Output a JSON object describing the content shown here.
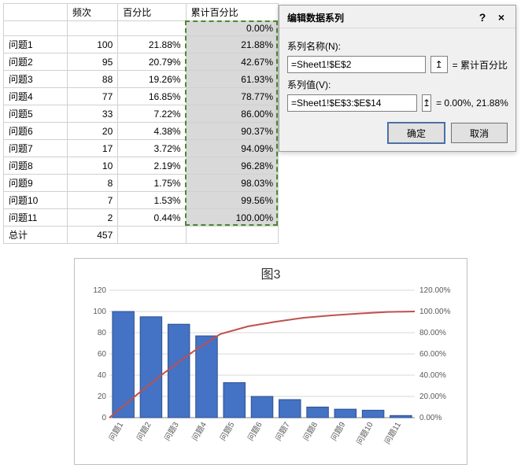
{
  "sheet": {
    "headers": {
      "row_label": "",
      "freq": "频次",
      "pct": "百分比",
      "cum": "累计百分比"
    },
    "first_cum": "0.00%",
    "rows": [
      {
        "label": "问题1",
        "freq": 100,
        "pct": "21.88%",
        "cum": "21.88%"
      },
      {
        "label": "问题2",
        "freq": 95,
        "pct": "20.79%",
        "cum": "42.67%"
      },
      {
        "label": "问题3",
        "freq": 88,
        "pct": "19.26%",
        "cum": "61.93%"
      },
      {
        "label": "问题4",
        "freq": 77,
        "pct": "16.85%",
        "cum": "78.77%"
      },
      {
        "label": "问题5",
        "freq": 33,
        "pct": "7.22%",
        "cum": "86.00%"
      },
      {
        "label": "问题6",
        "freq": 20,
        "pct": "4.38%",
        "cum": "90.37%"
      },
      {
        "label": "问题7",
        "freq": 17,
        "pct": "3.72%",
        "cum": "94.09%"
      },
      {
        "label": "问题8",
        "freq": 10,
        "pct": "2.19%",
        "cum": "96.28%"
      },
      {
        "label": "问题9",
        "freq": 8,
        "pct": "1.75%",
        "cum": "98.03%"
      },
      {
        "label": "问题10",
        "freq": 7,
        "pct": "1.53%",
        "cum": "99.56%"
      },
      {
        "label": "问题11",
        "freq": 2,
        "pct": "0.44%",
        "cum": "100.00%"
      }
    ],
    "total": {
      "label": "总计",
      "freq": 457
    }
  },
  "dialog": {
    "title": "编辑数据系列",
    "help_icon": "?",
    "close_icon": "×",
    "name_label": "系列名称(N):",
    "name_value": "=Sheet1!$E$2",
    "name_preview": "= 累计百分比",
    "values_label": "系列值(V):",
    "values_value": "=Sheet1!$E$3:$E$14",
    "values_preview": "= 0.00%, 21.88%",
    "ref_icon": "↥",
    "ok_label": "确定",
    "cancel_label": "取消"
  },
  "chart_data": {
    "type": "bar+line",
    "title": "图3",
    "categories": [
      "问题1",
      "问题2",
      "问题3",
      "问题4",
      "问题5",
      "问题6",
      "问题7",
      "问题8",
      "问题9",
      "问题10",
      "问题11"
    ],
    "series": [
      {
        "name": "频次",
        "kind": "bar",
        "axis": "left",
        "values": [
          100,
          95,
          88,
          77,
          33,
          20,
          17,
          10,
          8,
          7,
          2
        ]
      },
      {
        "name": "累计百分比",
        "kind": "line",
        "axis": "right",
        "values": [
          0.0,
          21.88,
          42.67,
          61.93,
          78.77,
          86.0,
          90.37,
          94.09,
          96.28,
          98.03,
          99.56,
          100.0
        ]
      }
    ],
    "y_left": {
      "min": 0,
      "max": 120,
      "step": 20,
      "ticks": [
        "0",
        "20",
        "40",
        "60",
        "80",
        "100",
        "120"
      ]
    },
    "y_right": {
      "min": 0,
      "max": 120,
      "step": 20,
      "ticks": [
        "0.00%",
        "20.00%",
        "40.00%",
        "60.00%",
        "80.00%",
        "100.00%",
        "120.00%"
      ]
    }
  }
}
